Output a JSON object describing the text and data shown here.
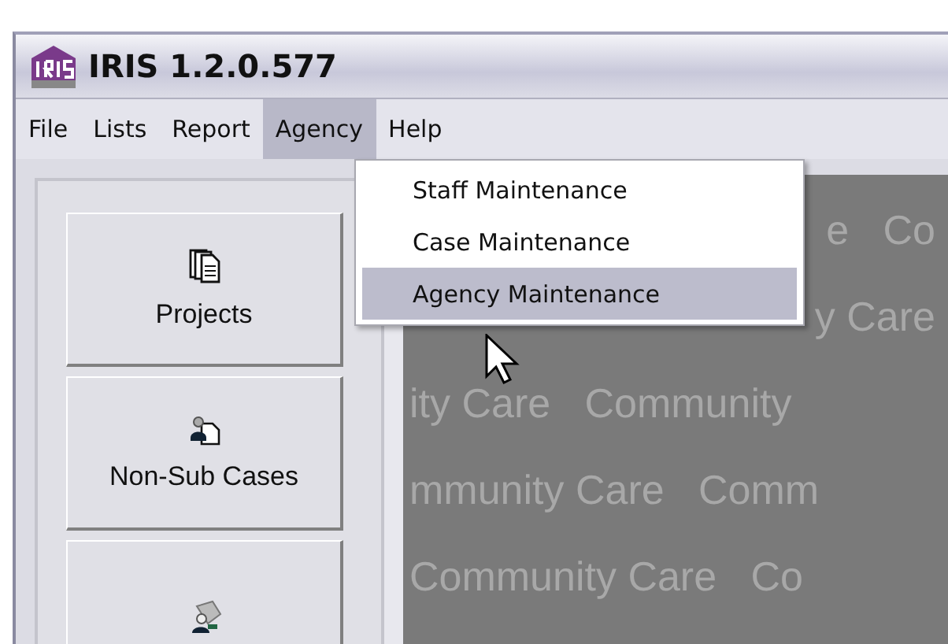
{
  "window": {
    "title": "IRIS 1.2.0.577"
  },
  "menu_bar": [
    {
      "label": "File",
      "selected": false
    },
    {
      "label": "Lists",
      "selected": false
    },
    {
      "label": "Report",
      "selected": false
    },
    {
      "label": "Agency",
      "selected": true
    },
    {
      "label": "Help",
      "selected": false
    }
  ],
  "dropdown": [
    {
      "label": "Staff Maintenance",
      "selected": false
    },
    {
      "label": "Case Maintenance",
      "selected": false
    },
    {
      "label": "Agency Maintenance",
      "selected": true
    }
  ],
  "sidebar": [
    {
      "label": "Projects",
      "kind": "projects"
    },
    {
      "label": "Non-Sub Cases",
      "kind": "cases"
    },
    {
      "kind": "partial"
    }
  ],
  "wallpaper": [
    {
      "text": "e   Co",
      "kind": "covered"
    },
    {
      "text": "y Care",
      "kind": "covered"
    },
    {
      "text": "ity Care   Community",
      "kind": "full"
    },
    {
      "text": "mmunity Care   Comm",
      "kind": "full"
    },
    {
      "text": "Community Care   Co",
      "kind": "full"
    }
  ]
}
